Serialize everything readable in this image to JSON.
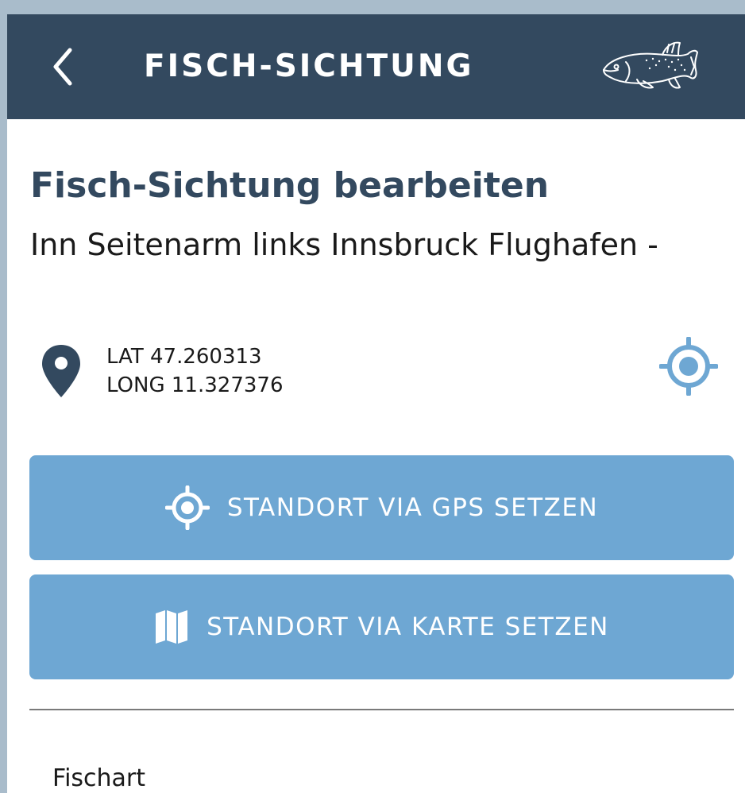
{
  "header": {
    "title": "FISCH-SICHTUNG",
    "back_icon": "chevron-left-icon",
    "logo_icon": "fish-logo",
    "background_color": "#33495f"
  },
  "main": {
    "title": "Fisch-Sichtung bearbeiten",
    "location_name": "Inn Seitenarm links Innsbruck Flughafen -",
    "coordinates": {
      "lat_label": "LAT 47.260313",
      "long_label": "LONG 11.327376",
      "pin_icon": "map-pin-icon",
      "locate_icon": "crosshair-icon",
      "locate_color": "#6ea7d3"
    },
    "buttons": {
      "gps_label": "STANDORT VIA GPS SETZEN",
      "gps_icon": "gps-crosshair-icon",
      "map_label": "STANDORT VIA KARTE SETZEN",
      "map_icon": "map-icon",
      "color": "#6ea7d3"
    },
    "form": {
      "fischart_label": "Fischart"
    }
  }
}
